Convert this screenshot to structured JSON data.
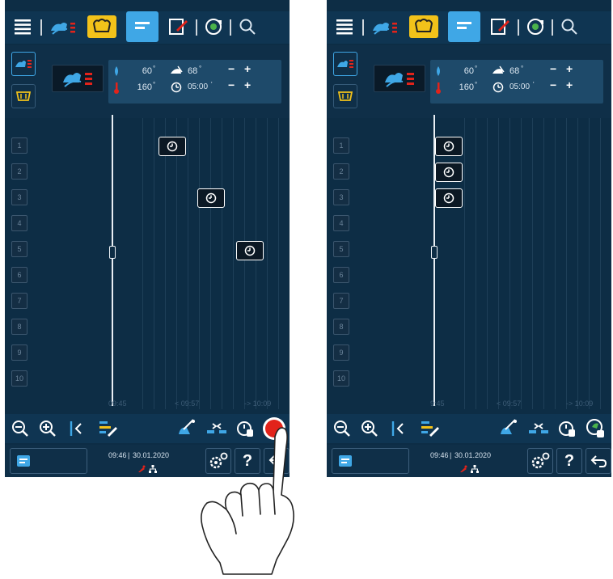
{
  "screens": [
    {
      "id": "left",
      "toolbar": {
        "icons": [
          "menu-icon",
          "cooking-paths-icon",
          "shop-icon",
          "planner-icon",
          "edit-icon",
          "intelligent-icon",
          "search-icon"
        ],
        "active": "planner-icon"
      },
      "params": {
        "humidity": "60",
        "humidity_unit": "°",
        "temperature": "160",
        "temperature_unit": "°",
        "core_temp": "68",
        "core_temp_unit": "°",
        "time": "05:00",
        "time_unit": "'"
      },
      "shelves": [
        "1",
        "2",
        "3",
        "4",
        "5",
        "6",
        "7",
        "8",
        "9",
        "10"
      ],
      "time_labels": [
        "09:45",
        "< 09:57",
        "-> 10:09"
      ],
      "scheduled_shelves": [
        1,
        3,
        5
      ],
      "status": {
        "time": "09:46",
        "date": "30.01.2020"
      },
      "bottom_action": "start-button"
    },
    {
      "id": "right",
      "toolbar": {
        "icons": [
          "menu-icon",
          "cooking-paths-icon",
          "shop-icon",
          "planner-icon",
          "edit-icon",
          "intelligent-icon",
          "search-icon"
        ],
        "active": "planner-icon"
      },
      "params": {
        "humidity": "60",
        "humidity_unit": "°",
        "temperature": "160",
        "temperature_unit": "°",
        "core_temp": "68",
        "core_temp_unit": "°",
        "time": "05:00",
        "time_unit": "'"
      },
      "shelves": [
        "1",
        "2",
        "3",
        "4",
        "5",
        "6",
        "7",
        "8",
        "9",
        "10"
      ],
      "time_labels": [
        "9:45",
        "< 09:57",
        "-> 10:09"
      ],
      "scheduled_shelves": [
        1,
        2,
        3
      ],
      "status": {
        "time": "09:46",
        "date": "30.01.2020"
      },
      "bottom_action": "apply-button"
    }
  ],
  "colors": {
    "background": "#0d2d45",
    "toolbar": "#0f3552",
    "active": "#3fa7e6",
    "accent_yellow": "#f2c21a",
    "record_red": "#e2231a",
    "green": "#4bb34b"
  }
}
